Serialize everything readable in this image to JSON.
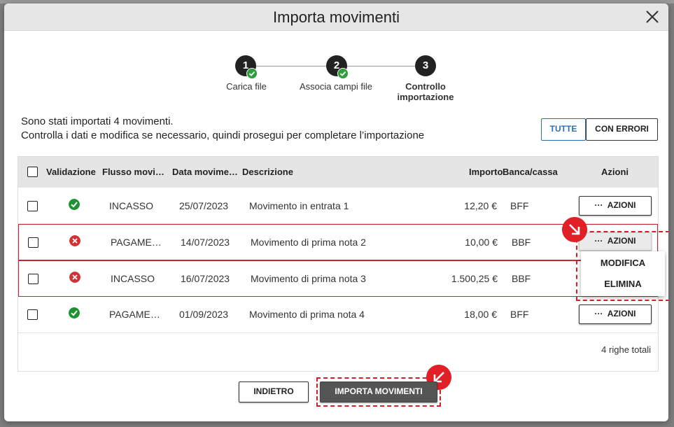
{
  "dialog": {
    "title": "Importa movimenti"
  },
  "stepper": {
    "steps": [
      {
        "number": "1",
        "label": "Carica file",
        "completed": true
      },
      {
        "number": "2",
        "label": "Associa campi file",
        "completed": true
      },
      {
        "number": "3",
        "label_line1": "Controllo",
        "label_line2": "importazione",
        "completed": false,
        "current": true
      }
    ]
  },
  "intro": {
    "line1": "Sono stati importati 4 movimenti.",
    "line2": "Controlla i dati e modifica se necessario, quindi prosegui per completare l’importazione"
  },
  "filters": {
    "all_label": "TUTTE",
    "errors_label": "CON ERRORI",
    "selected": "TUTTE"
  },
  "table": {
    "headers": {
      "validazione": "Validazione",
      "flusso": "Flusso movi…",
      "data": "Data movime…",
      "descrizione": "Descrizione",
      "importo": "Importo",
      "banca": "Banca/cassa",
      "azioni": "Azioni"
    },
    "rows": [
      {
        "status": "ok",
        "flusso": "INCASSO",
        "data": "25/07/2023",
        "descrizione": "Movimento in entrata 1",
        "importo": "12,20 €",
        "banca": "BFF",
        "action": "AZIONI"
      },
      {
        "status": "error",
        "flusso": "PAGAME…",
        "data": "14/07/2023",
        "descrizione": "Movimento di prima nota 2",
        "importo": "10,00 €",
        "banca": "BBF",
        "action": "AZIONI"
      },
      {
        "status": "error",
        "flusso": "INCASSO",
        "data": "16/07/2023",
        "descrizione": "Movimento di prima nota 3",
        "importo": "1.500,25 €",
        "banca": "BBF",
        "action": "AZIONI"
      },
      {
        "status": "ok",
        "flusso": "PAGAME…",
        "data": "01/09/2023",
        "descrizione": "Movimento di prima nota 4",
        "importo": "18,00 €",
        "banca": "BFF",
        "action": "AZIONI"
      }
    ],
    "total": "4 righe totali"
  },
  "actions_menu": {
    "items": [
      "MODIFICA",
      "ELIMINA"
    ]
  },
  "footer": {
    "back_label": "INDIETRO",
    "import_label": "IMPORTA MOVIMENTI"
  },
  "colors": {
    "accent": "#2a6fb0",
    "error": "#c2272d",
    "success": "#1e9232",
    "callout": "#e01f26"
  }
}
